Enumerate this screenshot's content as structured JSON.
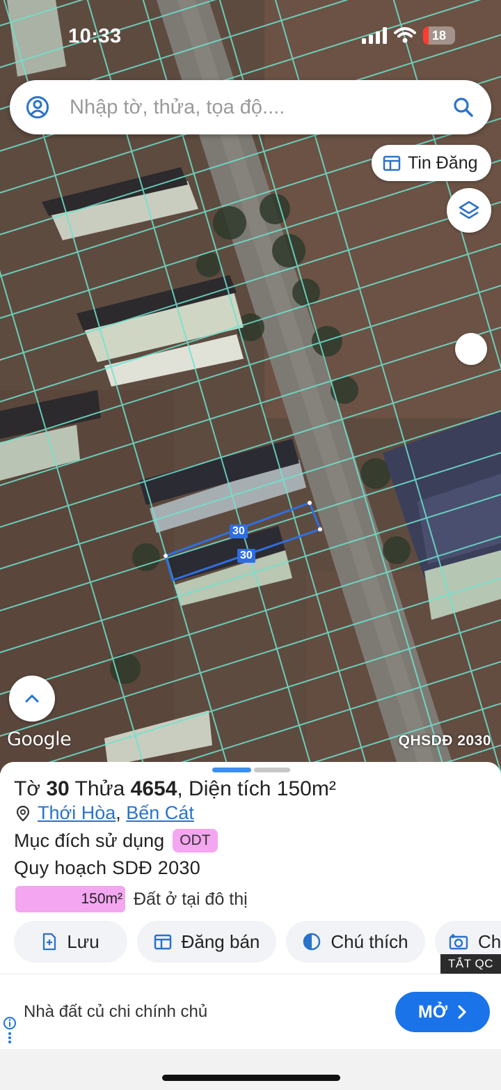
{
  "status": {
    "time": "10:33",
    "battery": "18"
  },
  "search": {
    "placeholder": "Nhập tờ, thửa, tọa độ...."
  },
  "map": {
    "tin_dang_label": "Tin Đăng",
    "google_label": "Google",
    "layer_label": "QHSDĐ 2030",
    "parcel_tags": [
      "30",
      "30"
    ]
  },
  "panel": {
    "title_prefix": "Tờ",
    "sheet_no": "30",
    "parcel_prefix": "Thửa",
    "parcel_no": "4654",
    "area_prefix": ", Diện tích",
    "area_value": "150m²",
    "ward": "Thới Hòa",
    "district": "Bến Cát",
    "purpose_label": "Mục đích sử dụng",
    "purpose_code": "ODT",
    "plan_label": "Quy hoạch SDĐ 2030",
    "plan_area": "150m²",
    "plan_desc": "Đất ở tại đô thị",
    "actions": [
      {
        "label": "Lưu",
        "icon": "bookmark-plus-icon"
      },
      {
        "label": "Đăng bán",
        "icon": "listing-icon"
      },
      {
        "label": "Chú thích",
        "icon": "contrast-icon"
      },
      {
        "label": "Ch",
        "icon": "camera-icon"
      }
    ]
  },
  "ad": {
    "close_label": "TẮT QC",
    "text": "Nhà đất củ chi chính chủ",
    "open_label": "MỞ"
  },
  "colors": {
    "accent": "#1a73e8",
    "parcel_line": "#6fe3d0",
    "badge": "#f4a6f0",
    "selected_parcel": "#2f6fe0"
  }
}
